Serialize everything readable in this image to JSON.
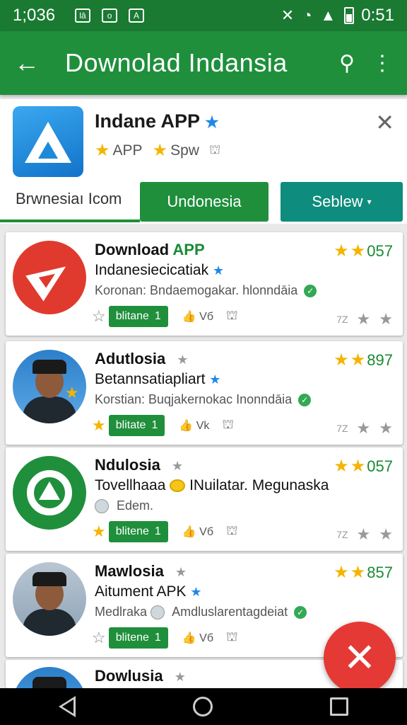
{
  "status_bar": {
    "time": "1;036",
    "notif_1": "lā",
    "notif_2": "o",
    "notif_3": "A",
    "clock": "0:51"
  },
  "app_bar": {
    "title": "Downolad Indansia"
  },
  "header": {
    "app_name": "Indane APP",
    "meta_1": "APP",
    "meta_2": "Spw"
  },
  "tabs": {
    "plain": "Brwnesiaı Icom",
    "active": "Undonesia",
    "dropdown": "Seblew"
  },
  "cards": [
    {
      "title": "Download",
      "title_accent": "APP",
      "rating": "057",
      "subtitle": "Indanesiecicatiak",
      "developer": "Koronan: Bndaemogakar. hlonndāia",
      "badge": "blitane",
      "badge_num": "1",
      "likes": "Vб",
      "zoom": "7Z"
    },
    {
      "title": "Adutlosia",
      "rating": "897",
      "subtitle": "Betannsatiapliart",
      "developer": "Korstian: Buqjakernokac Inonndāia",
      "badge": "blitate",
      "badge_num": "1",
      "likes": "Vk",
      "zoom": "7Z"
    },
    {
      "title": "Ndulosia",
      "rating": "057",
      "subtitle": "Tovellhaaa",
      "subtitle_2": "INuilatar. Megunaska",
      "developer": "Edem.",
      "badge": "blitene",
      "badge_num": "1",
      "likes": "Vб",
      "zoom": "7Z"
    },
    {
      "title": "Mawlosia",
      "rating": "857",
      "subtitle": "Aitument APK",
      "developer_prefix": "Medlraka",
      "developer": "Amdluslarentagdeiat",
      "badge": "blitene",
      "badge_num": "1",
      "likes": "Vб",
      "zoom": "7Z"
    },
    {
      "title": "Dowlusia"
    }
  ],
  "colors": {
    "primary": "#1f8f3c",
    "status_bar": "#1a7a32",
    "teal": "#0e8c7d",
    "fab": "#e53935",
    "star": "#f4b400"
  }
}
